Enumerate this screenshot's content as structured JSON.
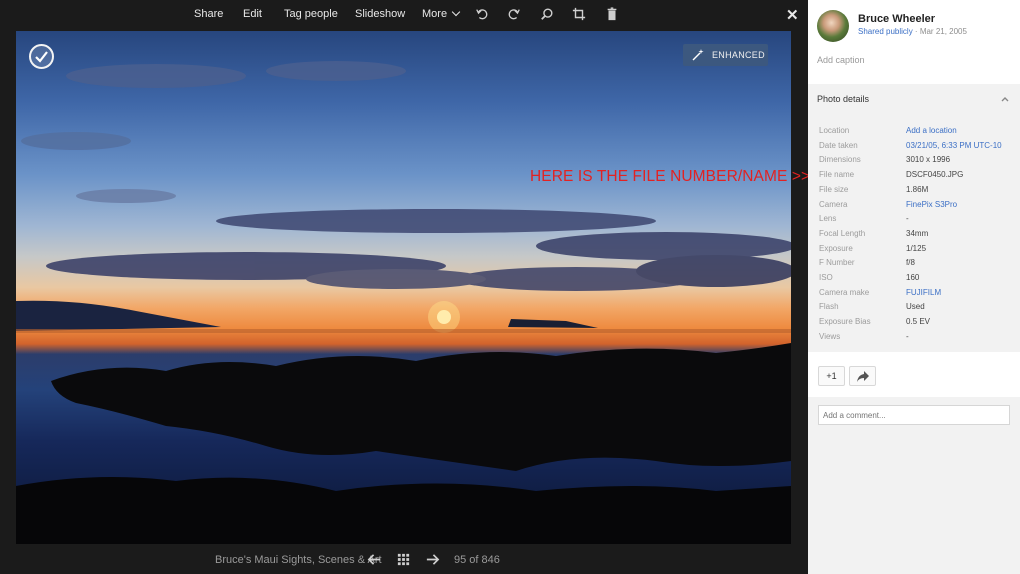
{
  "toolbar": {
    "share": "Share",
    "edit": "Edit",
    "tag_people": "Tag people",
    "slideshow": "Slideshow",
    "more": "More",
    "icons": [
      "rotate-left-icon",
      "rotate-right-icon",
      "zoom-icon",
      "crop-icon",
      "trash-icon"
    ],
    "close": "✕"
  },
  "photo": {
    "enhanced_label": "ENHANCED"
  },
  "annotation": "HERE IS THE FILE NUMBER/NAME >>",
  "bottom": {
    "album_title": "Bruce's Maui Sights, Scenes & Art",
    "counter": "95 of 846"
  },
  "panel": {
    "owner_name": "Bruce Wheeler",
    "shared_label": "Shared publicly",
    "shared_date": " · Mar 21, 2005",
    "caption_placeholder": "Add caption",
    "details_title": "Photo details",
    "details": [
      {
        "key": "Location",
        "value": "Add a location",
        "link": true
      },
      {
        "key": "Date taken",
        "value": "03/21/05, 6:33 PM UTC-10",
        "link": true
      },
      {
        "key": "Dimensions",
        "value": "3010 x 1996",
        "link": false
      },
      {
        "key": "File name",
        "value": "DSCF0450.JPG",
        "link": false
      },
      {
        "key": "File size",
        "value": "1.86M",
        "link": false
      },
      {
        "key": "Camera",
        "value": "FinePix S3Pro",
        "link": true
      },
      {
        "key": "Lens",
        "value": "-",
        "link": false
      },
      {
        "key": "Focal Length",
        "value": "34mm",
        "link": false
      },
      {
        "key": "Exposure",
        "value": "1/125",
        "link": false
      },
      {
        "key": "F Number",
        "value": "f/8",
        "link": false
      },
      {
        "key": "ISO",
        "value": "160",
        "link": false
      },
      {
        "key": "Camera make",
        "value": "FUJIFILM",
        "link": true
      },
      {
        "key": "Flash",
        "value": "Used",
        "link": false
      },
      {
        "key": "Exposure Bias",
        "value": "0.5 EV",
        "link": false
      },
      {
        "key": "Views",
        "value": "-",
        "link": false
      }
    ],
    "plus_one": "+1",
    "comment_placeholder": "Add a comment..."
  },
  "colors": {
    "link": "#3b6fc5",
    "annotation": "#e32222",
    "viewer_bg": "#1b1b1b",
    "enhanced_bg": "#3c587f"
  }
}
